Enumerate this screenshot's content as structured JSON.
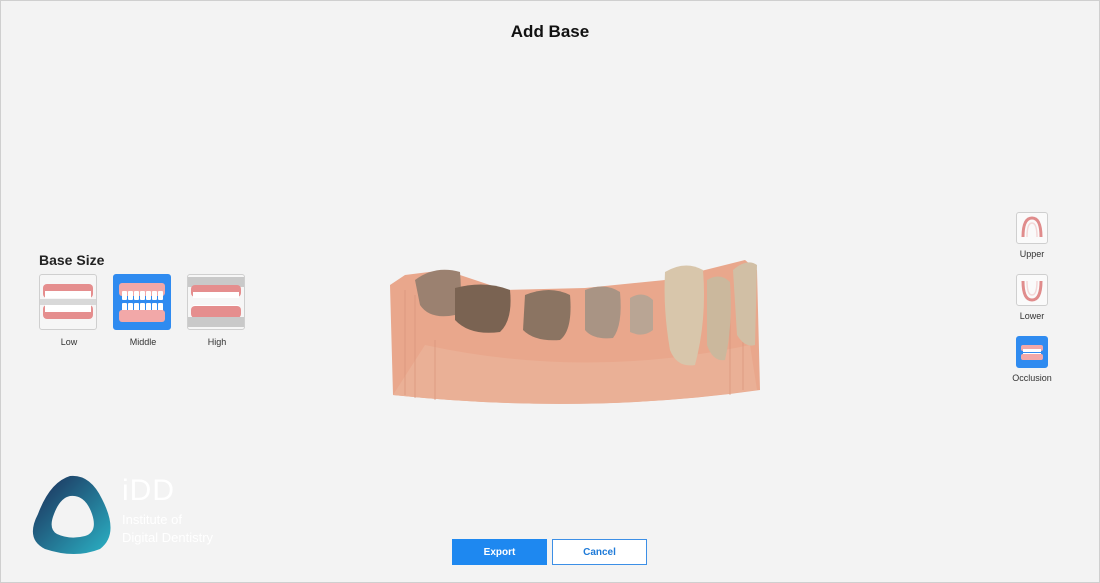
{
  "window": {
    "title": "Add Base"
  },
  "base_size": {
    "label": "Base Size",
    "selected": "Middle",
    "options": [
      {
        "label": "Low",
        "icon": "teeth-low-icon"
      },
      {
        "label": "Middle",
        "icon": "teeth-middle-icon"
      },
      {
        "label": "High",
        "icon": "teeth-high-icon"
      }
    ]
  },
  "views": {
    "selected": "Occlusion",
    "items": [
      {
        "label": "Upper",
        "icon": "upper-jaw-icon"
      },
      {
        "label": "Lower",
        "icon": "lower-jaw-icon"
      },
      {
        "label": "Occlusion",
        "icon": "occlusion-icon"
      }
    ]
  },
  "logo": {
    "brand": "iDD",
    "line1": "Institute of",
    "line2": "Digital Dentistry"
  },
  "actions": {
    "export_label": "Export",
    "cancel_label": "Cancel"
  },
  "colors": {
    "accent": "#1e88f0",
    "model_base": "#e9a78c",
    "gum": "#e8908c"
  }
}
